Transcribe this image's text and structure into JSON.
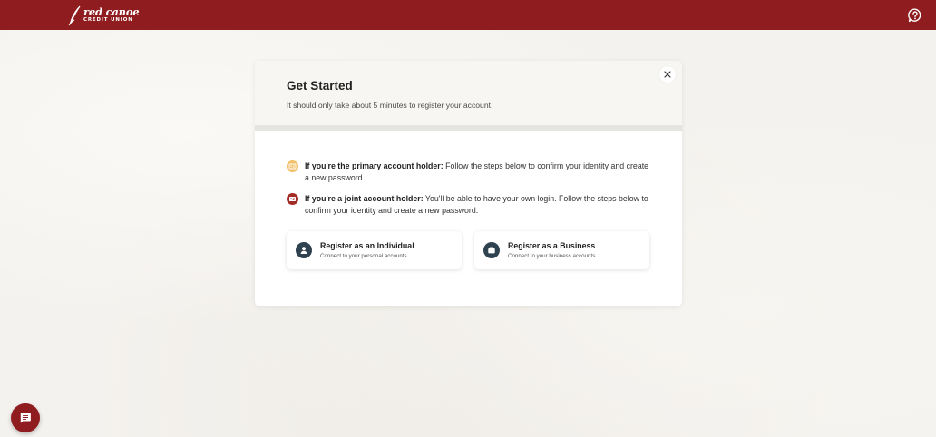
{
  "header": {
    "logo_name": "red canoe",
    "logo_sub": "CREDIT UNION",
    "brand_color": "#8f1d20",
    "help_icon": "question-chat-icon"
  },
  "card": {
    "title": "Get Started",
    "subtitle": "It should only take about 5 minutes to register your account.",
    "close_icon": "close-icon",
    "info": [
      {
        "icon": "id-card-icon",
        "bold": "If you're the primary account holder:",
        "text": " Follow the steps below to confirm your identity and create a new password."
      },
      {
        "icon": "id-card-icon",
        "bold": "If you're a joint account holder:",
        "text": " You'll be able to have your own login. Follow the steps below to confirm your identity and create a new password."
      }
    ],
    "options": [
      {
        "icon": "person-icon",
        "title": "Register as an Individual",
        "subtitle": "Connect to your personal accounts"
      },
      {
        "icon": "briefcase-icon",
        "title": "Register as a Business",
        "subtitle": "Connect to your business accounts"
      }
    ]
  },
  "chat": {
    "icon": "chat-icon"
  }
}
